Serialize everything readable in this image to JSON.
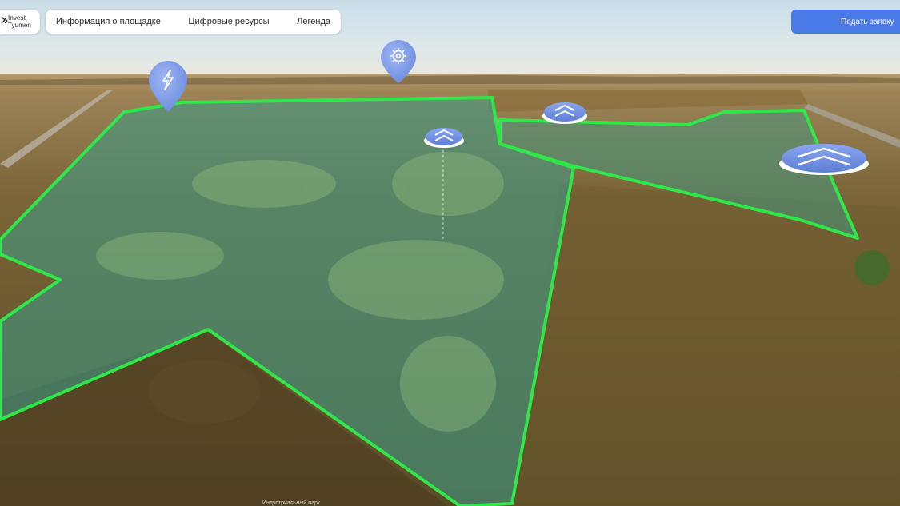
{
  "brand": {
    "logo_text": "Invest\nTyumen"
  },
  "topnav": {
    "items": [
      {
        "label": "Информация о площадке"
      },
      {
        "label": "Цифровые ресурсы"
      },
      {
        "label": "Легенда"
      }
    ]
  },
  "actions": {
    "apply_label": "Подать заявку"
  },
  "map": {
    "markers": [
      {
        "icon": "lightning-icon",
        "color": "#7b9be8"
      },
      {
        "icon": "gear-icon",
        "color": "#7b9be8"
      }
    ],
    "hotspots": [
      {
        "icon": "chevron-up-double-icon"
      },
      {
        "icon": "chevron-up-double-icon"
      },
      {
        "icon": "chevron-up-double-icon"
      }
    ],
    "boundary_color": "#2ee84a",
    "overlay_color": "#3f9b86"
  },
  "footer": {
    "scene_label": "Индустриальный парк"
  }
}
